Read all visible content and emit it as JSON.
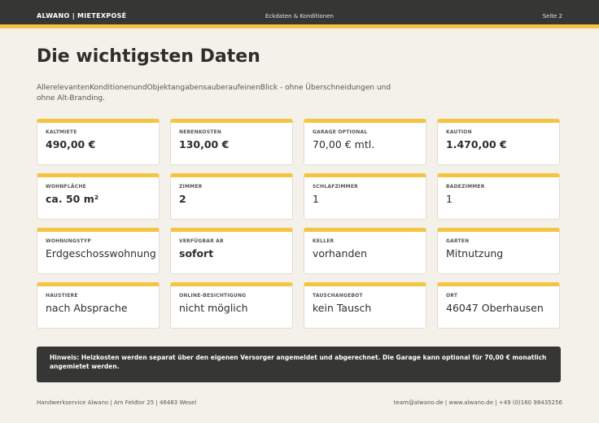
{
  "header": {
    "brand": "ALWANO | MIETEXPOSÉ",
    "section": "Eckdaten & Konditionen",
    "page": "Seite 2"
  },
  "title": "Die wichtigsten Daten",
  "subtitle": "AllerelevantenKonditionenundObjektangabensauberaufeinenBlick - ohne Überschneidungen und ohne Alt-Branding.",
  "cards": [
    {
      "label": "KALTMIETE",
      "value": "490,00 €",
      "bold": true
    },
    {
      "label": "NEBENKOSTEN",
      "value": "130,00 €",
      "bold": true
    },
    {
      "label": "GARAGE OPTIONAL",
      "value": "70,00 € mtl.",
      "bold": false
    },
    {
      "label": "KAUTION",
      "value": "1.470,00 €",
      "bold": true
    },
    {
      "label": "WOHNFLÄCHE",
      "value": "ca. 50 m²",
      "bold": true
    },
    {
      "label": "ZIMMER",
      "value": "2",
      "bold": true
    },
    {
      "label": "SCHLAFZIMMER",
      "value": "1",
      "bold": false
    },
    {
      "label": "BADEZIMMER",
      "value": "1",
      "bold": false
    },
    {
      "label": "WOHNUNGSTYP",
      "value": "Erdgeschosswohnung",
      "bold": false
    },
    {
      "label": "VERFÜGBAR AB",
      "value": "sofort",
      "bold": true
    },
    {
      "label": "KELLER",
      "value": "vorhanden",
      "bold": false
    },
    {
      "label": "GARTEN",
      "value": "Mitnutzung",
      "bold": false
    },
    {
      "label": "HAUSTIERE",
      "value": "nach Absprache",
      "bold": false
    },
    {
      "label": "ONLINE-BESICHTIGUNG",
      "value": "nicht möglich",
      "bold": false
    },
    {
      "label": "TAUSCHANGEBOT",
      "value": "kein Tausch",
      "bold": false
    },
    {
      "label": "ORT",
      "value": "46047 Oberhausen",
      "bold": false
    }
  ],
  "note": "Hinweis: Heizkosten werden separat über den eigenen Versorger angemeldet und abgerechnet. Die Garage kann optional für 70,00 € monatlich angemietet werden.",
  "footer": {
    "left": "Handwerkservice Alwano | Am Feldtor 25 | 46483 Wesel",
    "right": "team@alwano.de | www.alwano.de | +49 (0)160 98435256"
  },
  "colors": {
    "accent": "#f3c543",
    "dark": "#363734",
    "background": "#f4f1ea"
  }
}
